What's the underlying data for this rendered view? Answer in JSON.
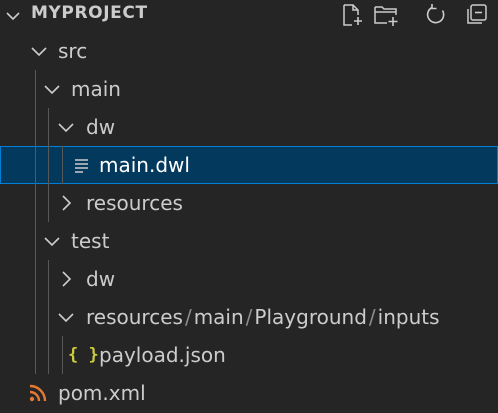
{
  "explorer": {
    "section_title": "MYPROJECT",
    "actions": [
      {
        "name": "new-file",
        "icon": "new-file-icon"
      },
      {
        "name": "new-folder",
        "icon": "new-folder-icon"
      },
      {
        "name": "refresh",
        "icon": "refresh-icon"
      },
      {
        "name": "collapse-all",
        "icon": "collapse-all-icon"
      }
    ],
    "tree": [
      {
        "label": "src",
        "type": "folder",
        "expanded": true
      },
      {
        "label": "main",
        "type": "folder",
        "expanded": true
      },
      {
        "label": "dw",
        "type": "folder",
        "expanded": true
      },
      {
        "label": "main.dwl",
        "type": "file",
        "icon": "text-file-icon",
        "selected": true
      },
      {
        "label": "resources",
        "type": "folder",
        "expanded": false
      },
      {
        "label": "test",
        "type": "folder",
        "expanded": true
      },
      {
        "label": "dw",
        "type": "folder",
        "expanded": false
      },
      {
        "type": "compact-folder",
        "expanded": true,
        "segments": [
          "resources",
          "main",
          "Playground",
          "inputs"
        ],
        "separator": "/"
      },
      {
        "label": "payload.json",
        "type": "file",
        "icon": "json-icon",
        "icon_text": "{ }"
      },
      {
        "label": "pom.xml",
        "type": "file",
        "icon": "rss-icon"
      }
    ]
  },
  "colors": {
    "background": "#252526",
    "selection": "#04395e",
    "selection_border": "#007fd4",
    "text": "#cccccc",
    "json_icon": "#cbcb41",
    "xml_icon": "#e37933"
  }
}
